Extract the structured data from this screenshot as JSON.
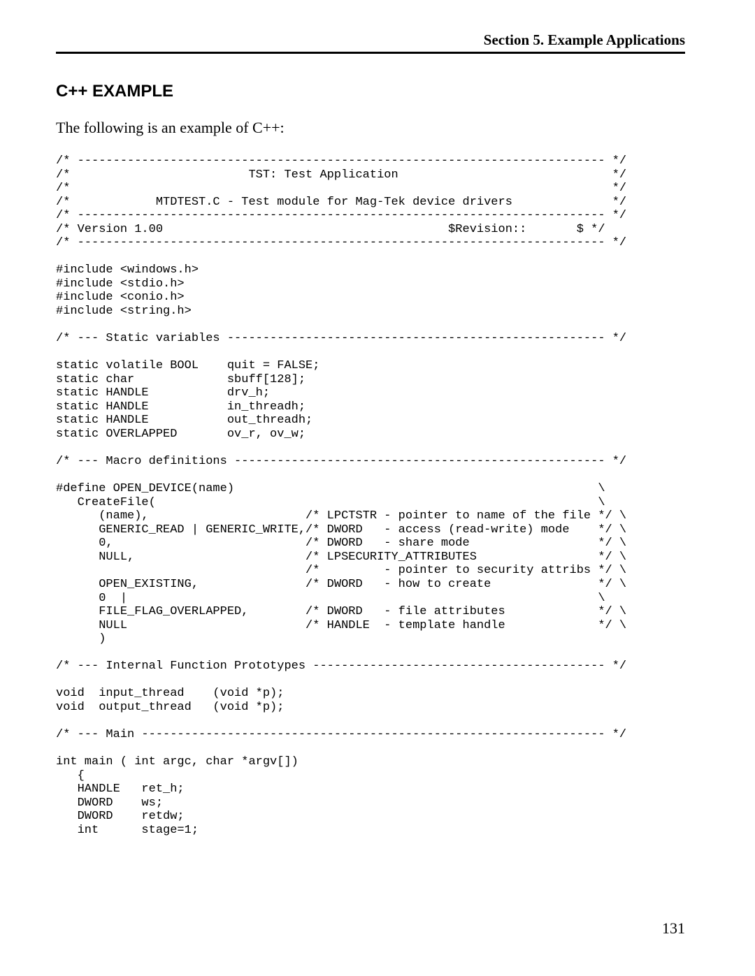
{
  "header": {
    "section": "Section 5.  Example Applications"
  },
  "title": "C++ EXAMPLE",
  "intro": "The following is an example of C++:",
  "code": "/* -------------------------------------------------------------------------- */\n/*                         TST: Test Application                              */\n/*                                                                            */\n/*            MTDTEST.C - Test module for Mag-Tek device drivers              */\n/* -------------------------------------------------------------------------- */\n/* Version 1.00                                        $Revision::       $ */\n/* -------------------------------------------------------------------------- */\n\n#include <windows.h>\n#include <stdio.h>\n#include <conio.h>\n#include <string.h>\n\n/* --- Static variables ----------------------------------------------------- */\n\nstatic volatile BOOL    quit = FALSE;\nstatic char             sbuff[128];\nstatic HANDLE           drv_h;\nstatic HANDLE           in_threadh;\nstatic HANDLE           out_threadh;\nstatic OVERLAPPED       ov_r, ov_w;\n\n/* --- Macro definitions ---------------------------------------------------- */\n\n#define OPEN_DEVICE(name)                                                   \\\n   CreateFile(                                                              \\\n      (name),                      /* LPCTSTR - pointer to name of the file */ \\\n      GENERIC_READ | GENERIC_WRITE,/* DWORD   - access (read-write) mode    */ \\\n      0,                           /* DWORD   - share mode                  */ \\\n      NULL,                        /* LPSECURITY_ATTRIBUTES                 */ \\\n                                   /*         - pointer to security attribs */ \\\n      OPEN_EXISTING,               /* DWORD   - how to create               */ \\\n      0  |                                                                  \\\n      FILE_FLAG_OVERLAPPED,        /* DWORD   - file attributes             */ \\\n      NULL                         /* HANDLE  - template handle             */ \\\n      )\n\n/* --- Internal Function Prototypes ----------------------------------------- */\n\nvoid  input_thread    (void *p);\nvoid  output_thread   (void *p);\n\n/* --- Main ----------------------------------------------------------------- */\n\nint main ( int argc, char *argv[])\n   {\n   HANDLE   ret_h;\n   DWORD    ws;\n   DWORD    retdw;\n   int      stage=1;",
  "page_number": "131"
}
